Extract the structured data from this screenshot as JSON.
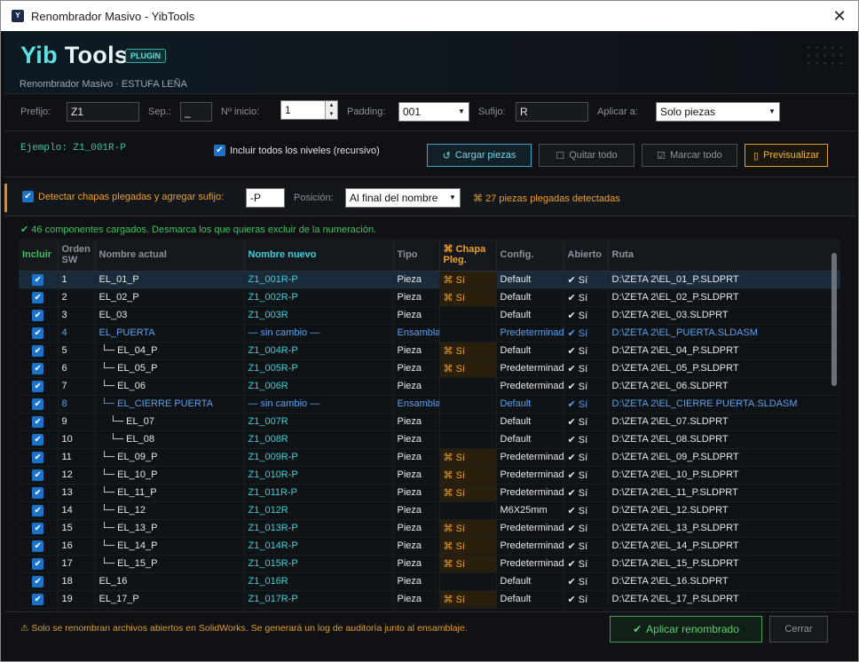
{
  "window": {
    "title": "Renombrador Masivo - YibTools"
  },
  "header": {
    "brand_yib": "Yib",
    "brand_tools": "Tools",
    "badge": "PLUGIN",
    "subtitle": "Renombrador Masivo · ESTUFA LEÑA"
  },
  "form": {
    "prefix_label": "Prefijo:",
    "prefix_value": "Z1",
    "sep_label": "Sep.:",
    "sep_value": "_",
    "start_label": "Nº inicio:",
    "start_value": "1",
    "padding_label": "Padding:",
    "padding_value": "001",
    "suffix_label": "Sufijo:",
    "suffix_value": "R",
    "apply_to_label": "Aplicar a:",
    "apply_to_value": "Solo piezas"
  },
  "example": "Ejemplo: Z1_001R-P",
  "recursive_label": "Incluir todos los niveles (recursivo)",
  "buttons": {
    "load": "Cargar piezas",
    "remove_all": "Quitar todo",
    "mark_all": "Marcar todo",
    "preview": "Previsualizar",
    "apply": "Aplicar renombrado",
    "close": "Cerrar"
  },
  "sheet": {
    "label": "Detectar chapas plegadas y agregar sufijo:",
    "suffix": "-P",
    "position_label": "Posición:",
    "position_value": "Al final del nombre",
    "detected": "27 piezas plegadas detectadas"
  },
  "status": "46 componentes cargados. Desmarca los que quieras excluir de la numeración.",
  "columns": [
    "Incluir",
    "Orden SW",
    "Nombre actual",
    "Nombre nuevo",
    "Tipo",
    "Chapa Pleg.",
    "Config.",
    "Abierto",
    "Ruta"
  ],
  "rows": [
    {
      "n": "1",
      "name": "EL_01_P",
      "new": "Z1_001R-P",
      "type": "Pieza",
      "chapa": "Sí",
      "config": "Default",
      "open": "Sí",
      "path": "D:\\ZETA 2\\EL_01_P.SLDPRT"
    },
    {
      "n": "2",
      "name": "EL_02_P",
      "new": "Z1_002R-P",
      "type": "Pieza",
      "chapa": "Sí",
      "config": "Default",
      "open": "Sí",
      "path": "D:\\ZETA 2\\EL_02_P.SLDPRT"
    },
    {
      "n": "3",
      "name": "EL_03",
      "new": "Z1_003R",
      "type": "Pieza",
      "chapa": "",
      "config": "Default",
      "open": "Sí",
      "path": "D:\\ZETA 2\\EL_03.SLDPRT"
    },
    {
      "n": "4",
      "name": "EL_PUERTA",
      "new": "— sin cambio —",
      "type": "Ensamblaje",
      "chapa": "",
      "config": "Predeterminado",
      "open": "Sí",
      "path": "D:\\ZETA 2\\EL_PUERTA.SLDASM"
    },
    {
      "n": "5",
      "name": "└─ EL_04_P",
      "new": "Z1_004R-P",
      "type": "Pieza",
      "chapa": "Sí",
      "config": "Default",
      "open": "Sí",
      "path": "D:\\ZETA 2\\EL_04_P.SLDPRT"
    },
    {
      "n": "6",
      "name": "└─ EL_05_P",
      "new": "Z1_005R-P",
      "type": "Pieza",
      "chapa": "Sí",
      "config": "Predeterminado",
      "open": "Sí",
      "path": "D:\\ZETA 2\\EL_05_P.SLDPRT"
    },
    {
      "n": "7",
      "name": "└─ EL_06",
      "new": "Z1_006R",
      "type": "Pieza",
      "chapa": "",
      "config": "Predeterminado",
      "open": "Sí",
      "path": "D:\\ZETA 2\\EL_06.SLDPRT"
    },
    {
      "n": "8",
      "name": "└─ EL_CIERRE PUERTA",
      "new": "— sin cambio —",
      "type": "Ensamblaje",
      "chapa": "",
      "config": "Default",
      "open": "Sí",
      "path": "D:\\ZETA 2\\EL_CIERRE PUERTA.SLDASM"
    },
    {
      "n": "9",
      "name": "└─ EL_07",
      "new": "Z1_007R",
      "type": "Pieza",
      "chapa": "",
      "config": "Default",
      "open": "Sí",
      "path": "D:\\ZETA 2\\EL_07.SLDPRT"
    },
    {
      "n": "10",
      "name": "└─ EL_08",
      "new": "Z1_008R",
      "type": "Pieza",
      "chapa": "",
      "config": "Default",
      "open": "Sí",
      "path": "D:\\ZETA 2\\EL_08.SLDPRT"
    },
    {
      "n": "11",
      "name": "└─ EL_09_P",
      "new": "Z1_009R-P",
      "type": "Pieza",
      "chapa": "Sí",
      "config": "Predeterminado",
      "open": "Sí",
      "path": "D:\\ZETA 2\\EL_09_P.SLDPRT"
    },
    {
      "n": "12",
      "name": "└─ EL_10_P",
      "new": "Z1_010R-P",
      "type": "Pieza",
      "chapa": "Sí",
      "config": "Predeterminado",
      "open": "Sí",
      "path": "D:\\ZETA 2\\EL_10_P.SLDPRT"
    },
    {
      "n": "13",
      "name": "└─ EL_11_P",
      "new": "Z1_011R-P",
      "type": "Pieza",
      "chapa": "Sí",
      "config": "Predeterminado",
      "open": "Sí",
      "path": "D:\\ZETA 2\\EL_11_P.SLDPRT"
    },
    {
      "n": "14",
      "name": "└─ EL_12",
      "new": "Z1_012R",
      "type": "Pieza",
      "chapa": "",
      "config": "M6X25mm",
      "open": "Sí",
      "path": "D:\\ZETA 2\\EL_12.SLDPRT"
    },
    {
      "n": "15",
      "name": "└─ EL_13_P",
      "new": "Z1_013R-P",
      "type": "Pieza",
      "chapa": "Sí",
      "config": "Predeterminado",
      "open": "Sí",
      "path": "D:\\ZETA 2\\EL_13_P.SLDPRT"
    },
    {
      "n": "16",
      "name": "└─ EL_14_P",
      "new": "Z1_014R-P",
      "type": "Pieza",
      "chapa": "Sí",
      "config": "Predeterminado",
      "open": "Sí",
      "path": "D:\\ZETA 2\\EL_14_P.SLDPRT"
    },
    {
      "n": "17",
      "name": "└─ EL_15_P",
      "new": "Z1_015R-P",
      "type": "Pieza",
      "chapa": "Sí",
      "config": "Predeterminado",
      "open": "Sí",
      "path": "D:\\ZETA 2\\EL_15_P.SLDPRT"
    },
    {
      "n": "18",
      "name": "EL_16",
      "new": "Z1_016R",
      "type": "Pieza",
      "chapa": "",
      "config": "Default",
      "open": "Sí",
      "path": "D:\\ZETA 2\\EL_16.SLDPRT"
    },
    {
      "n": "19",
      "name": "EL_17_P",
      "new": "Z1_017R-P",
      "type": "Pieza",
      "chapa": "Sí",
      "config": "Default",
      "open": "Sí",
      "path": "D:\\ZETA 2\\EL_17_P.SLDPRT"
    }
  ],
  "footer_warning": "Solo se renombran archivos abiertos en SolidWorks. Se generará un log de auditoría junto al ensamblaje."
}
